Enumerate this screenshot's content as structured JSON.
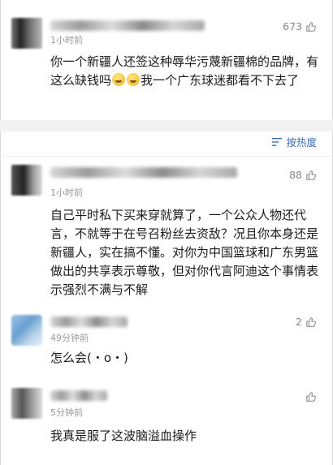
{
  "sort": {
    "label": "按热度",
    "icon": "sort-lines-icon"
  },
  "comments": [
    {
      "time": "1小时前",
      "likes": "673",
      "text": "你一个新疆人还签这种辱华污蔑新疆棉的品牌，有这么缺钱吗",
      "text_tail": "我一个广东球迷都看不下去了",
      "emoji": "worried-face-icon"
    },
    {
      "time": "1小时前",
      "likes": "88",
      "text": "自己平时私下买来穿就算了，一个公众人物还代言，不就等于在号召粉丝去资敌？况且你本身还是新疆人，实在搞不懂。对你为中国篮球和广东男篮做出的共享表示尊敬，但对你代言阿迪这个事情表示强烈不满与不解"
    },
    {
      "time": "49分钟前",
      "likes": "2",
      "text": "怎么会(・o・)"
    },
    {
      "time": "5分钟前",
      "likes": "",
      "text": "我真是服了这波脑溢血操作"
    }
  ],
  "colors": {
    "link": "#3b6fb5",
    "meta": "#999999",
    "divider": "#f2f2f2"
  }
}
